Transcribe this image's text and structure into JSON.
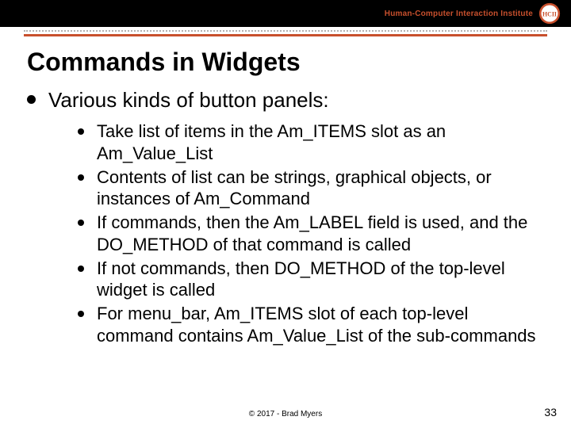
{
  "header": {
    "institute_label": "Human-Computer Interaction Institute",
    "logo_name": "hcii-logo"
  },
  "slide": {
    "title": "Commands in Widgets",
    "level1": "Various kinds of button panels:",
    "bullets": [
      "Take list of items in the Am_ITEMS slot as an Am_Value_List",
      "Contents of list can be strings, graphical objects, or instances of Am_Command",
      "If commands, then the Am_LABEL field is used, and the DO_METHOD of that command is called",
      "If not commands, then DO_METHOD of the top-level widget is called",
      "For menu_bar, Am_ITEMS slot of each top-level command contains Am_Value_List of the sub-commands"
    ]
  },
  "footer": {
    "copyright": "© 2017 - Brad Myers",
    "page_number": "33"
  }
}
